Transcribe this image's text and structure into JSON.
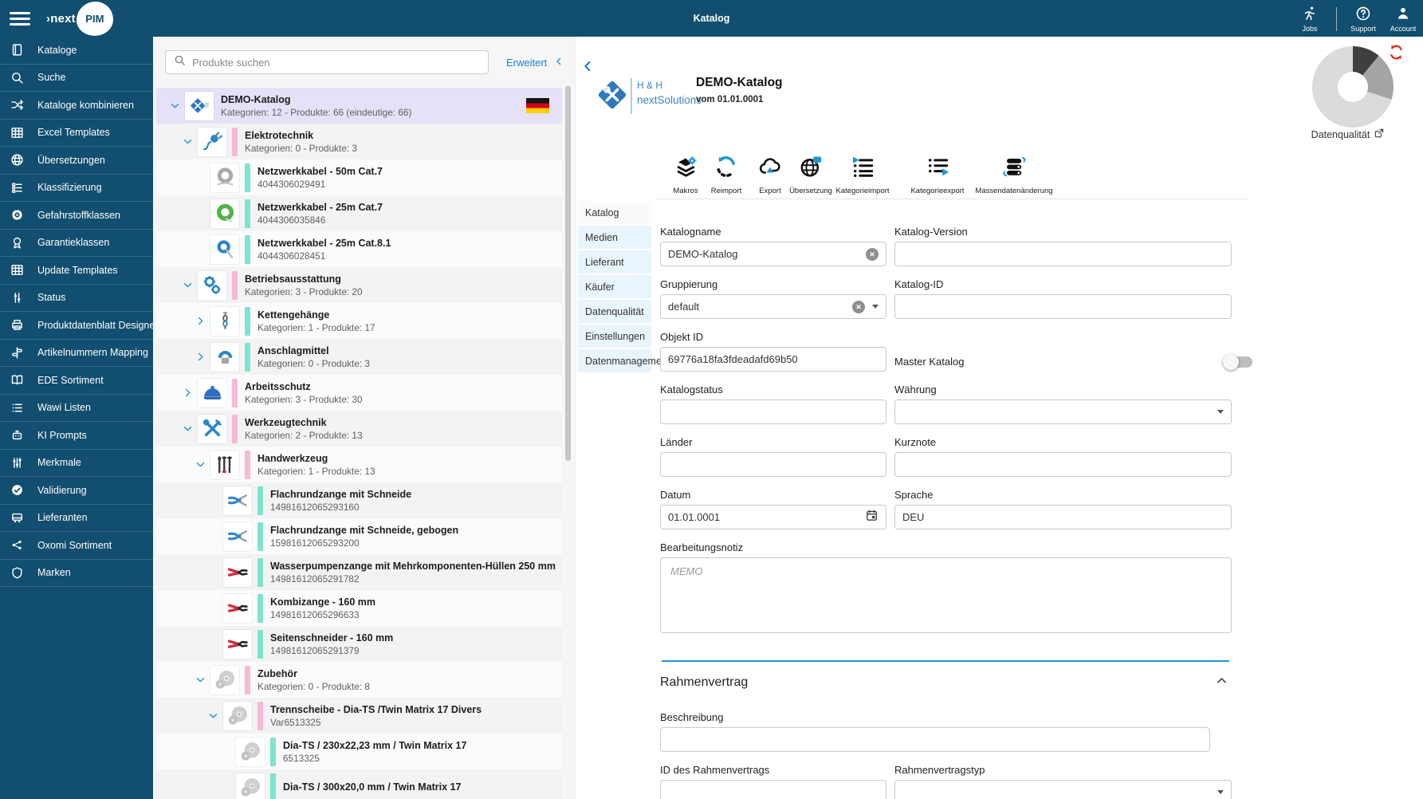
{
  "topbar": {
    "title": "Katalog",
    "logo": {
      "prefix": "›next",
      "suffix": "PIM"
    },
    "jobs_label": "Jobs",
    "support_label": "Support",
    "account_label": "Account"
  },
  "sidebar": {
    "items": [
      {
        "label": "Kataloge",
        "icon": "book-icon"
      },
      {
        "label": "Suche",
        "icon": "search-icon"
      },
      {
        "label": "Kataloge kombinieren",
        "icon": "shuffle-icon"
      },
      {
        "label": "Excel Templates",
        "icon": "table-icon"
      },
      {
        "label": "Übersetzungen",
        "icon": "globe-icon"
      },
      {
        "label": "Klassifizierung",
        "icon": "list-grid-icon"
      },
      {
        "label": "Gefahrstoffklassen",
        "icon": "radiation-icon"
      },
      {
        "label": "Garantieklassen",
        "icon": "award-icon"
      },
      {
        "label": "Update Templates",
        "icon": "table-icon"
      },
      {
        "label": "Status",
        "icon": "status-icon"
      },
      {
        "label": "Produktdatenblatt Designer",
        "icon": "printer-icon"
      },
      {
        "label": "Artikelnummern Mapping",
        "icon": "signpost-icon"
      },
      {
        "label": "EDE Sortiment",
        "icon": "open-book-icon"
      },
      {
        "label": "Wawi Listen",
        "icon": "list-icon"
      },
      {
        "label": "KI Prompts",
        "icon": "robot-icon"
      },
      {
        "label": "Merkmale",
        "icon": "sliders-icon"
      },
      {
        "label": "Validierung",
        "icon": "check-badge-icon"
      },
      {
        "label": "Lieferanten",
        "icon": "truck-icon"
      },
      {
        "label": "Oxomi Sortiment",
        "icon": "share-icon"
      },
      {
        "label": "Marken",
        "icon": "shield-icon"
      }
    ]
  },
  "tree": {
    "search_placeholder": "Produkte suchen",
    "advanced_label": "Erweitert",
    "rows": [
      {
        "level": 0,
        "chevron": "down",
        "thumb": "hh-logo",
        "bar": null,
        "title": "DEMO-Katalog",
        "subtitle": "Kategorien: 12 - Produkte: 66 (eindeutige: 66)",
        "selected": true,
        "flag": true
      },
      {
        "level": 1,
        "chevron": "down",
        "thumb": "plug",
        "bar": "pink",
        "title": "Elektrotechnik",
        "subtitle": "Kategorien: 0 - Produkte: 3"
      },
      {
        "level": 2,
        "chevron": null,
        "thumb": "cable-gray",
        "bar": "teal",
        "title": "Netzwerkkabel - 50m Cat.7",
        "subtitle": "4044306029491"
      },
      {
        "level": 2,
        "chevron": null,
        "thumb": "cable-green",
        "bar": "teal",
        "title": "Netzwerkkabel - 25m Cat.7",
        "subtitle": "4044306035846"
      },
      {
        "level": 2,
        "chevron": null,
        "thumb": "cable-blue",
        "bar": "teal",
        "title": "Netzwerkkabel - 25m Cat.8.1",
        "subtitle": "4044306028451"
      },
      {
        "level": 1,
        "chevron": "down",
        "thumb": "gears",
        "bar": "pink",
        "title": "Betriebsausstattung",
        "subtitle": "Kategorien: 3 - Produkte: 20"
      },
      {
        "level": 2,
        "chevron": "right",
        "thumb": "chain",
        "bar": "teal",
        "title": "Kettengehänge",
        "subtitle": "Kategorien: 1 - Produkte: 17"
      },
      {
        "level": 2,
        "chevron": "right",
        "thumb": "ring",
        "bar": "teal",
        "title": "Anschlagmittel",
        "subtitle": "Kategorien: 0 - Produkte: 3"
      },
      {
        "level": 1,
        "chevron": "right",
        "thumb": "helmet",
        "bar": "pink",
        "title": "Arbeitsschutz",
        "subtitle": "Kategorien: 3 - Produkte: 30"
      },
      {
        "level": 1,
        "chevron": "down",
        "thumb": "tools",
        "bar": "pink",
        "title": "Werkzeugtechnik",
        "subtitle": "Kategorien: 2 - Produkte: 13"
      },
      {
        "level": 2,
        "chevron": "down",
        "thumb": "handtools",
        "bar": "pink",
        "title": "Handwerkzeug",
        "subtitle": "Kategorien: 1 - Produkte: 13"
      },
      {
        "level": 3,
        "chevron": null,
        "thumb": "pliers-blue",
        "bar": "teal",
        "title": "Flachrundzange mit Schneide",
        "subtitle": "14981612065293160"
      },
      {
        "level": 3,
        "chevron": null,
        "thumb": "pliers-blue",
        "bar": "teal",
        "title": "Flachrundzange mit Schneide, gebogen",
        "subtitle": "15981612065293200"
      },
      {
        "level": 3,
        "chevron": null,
        "thumb": "pliers-red",
        "bar": "teal",
        "title": "Wasserpumpenzange mit Mehrkomponenten-Hüllen 250 mm",
        "subtitle": "14981612065291782"
      },
      {
        "level": 3,
        "chevron": null,
        "thumb": "pliers-red",
        "bar": "teal",
        "title": "Kombizange - 160 mm",
        "subtitle": "14981612065296633"
      },
      {
        "level": 3,
        "chevron": null,
        "thumb": "pliers-red",
        "bar": "teal",
        "title": "Seitenschneider - 160 mm",
        "subtitle": "14981612065291379"
      },
      {
        "level": 2,
        "chevron": "down",
        "thumb": "disc",
        "bar": "pink",
        "title": "Zubehör",
        "subtitle": "Kategorien: 0 - Produkte: 8"
      },
      {
        "level": 3,
        "chevron": "down",
        "thumb": "disc",
        "bar": "pink",
        "title": "Trennscheibe - Dia-TS /Twin Matrix 17 Divers",
        "subtitle": "Var6513325"
      },
      {
        "level": 4,
        "chevron": null,
        "thumb": "disc",
        "bar": "teal",
        "title": "Dia-TS / 230x22,23 mm / Twin Matrix 17",
        "subtitle": "6513325"
      },
      {
        "level": 4,
        "chevron": null,
        "thumb": "disc",
        "bar": "teal",
        "title": "Dia-TS / 300x20,0 mm / Twin Matrix 17",
        "subtitle": ""
      }
    ]
  },
  "detail": {
    "logo_line1": "H & H",
    "logo_line2": "nextSolutions",
    "title": "DEMO-Katalog",
    "subtitle": "vom 01.01.0001",
    "quality_label": "Datenqualität",
    "toolbar": [
      {
        "label": "Makros",
        "icon": "layers-gear-icon"
      },
      {
        "label": "Reimport",
        "icon": "reimport-icon"
      },
      {
        "label": "Export",
        "icon": "cloud-upload-icon"
      },
      {
        "label": "Übersetzung",
        "icon": "globe-chat-icon"
      },
      {
        "label": "Kategorieimport",
        "icon": "list-import-icon"
      },
      {
        "label": "Kategorieexport",
        "icon": "list-export-icon"
      },
      {
        "label": "Massendatenänderung",
        "icon": "database-sync-icon"
      }
    ],
    "tabs": [
      {
        "label": "Katalog",
        "active": true
      },
      {
        "label": "Medien",
        "active": false
      },
      {
        "label": "Lieferant",
        "active": false
      },
      {
        "label": "Käufer",
        "active": false
      },
      {
        "label": "Datenqualität",
        "active": false
      },
      {
        "label": "Einstellungen",
        "active": false
      },
      {
        "label": "Datenmanagement",
        "active": false
      }
    ],
    "form": {
      "katalogname": {
        "label": "Katalogname",
        "value": "DEMO-Katalog"
      },
      "katalog_version": {
        "label": "Katalog-Version",
        "value": ""
      },
      "gruppierung": {
        "label": "Gruppierung",
        "value": "default"
      },
      "katalog_id": {
        "label": "Katalog-ID",
        "value": ""
      },
      "objekt_id": {
        "label": "Objekt ID",
        "value": "69776a18fa3fdeadafd69b50"
      },
      "master_katalog": {
        "label": "Master Katalog",
        "enabled": false
      },
      "katalogstatus": {
        "label": "Katalogstatus",
        "value": ""
      },
      "waehrung": {
        "label": "Währung",
        "value": ""
      },
      "laender": {
        "label": "Länder",
        "value": ""
      },
      "kurznote": {
        "label": "Kurznote",
        "value": ""
      },
      "datum": {
        "label": "Datum",
        "value": "01.01.0001"
      },
      "sprache": {
        "label": "Sprache",
        "value": "DEU"
      },
      "bearbeitungsnotiz": {
        "label": "Bearbeitungsnotiz",
        "placeholder": "MEMO"
      }
    },
    "rahmenvertrag": {
      "title": "Rahmenvertrag",
      "beschreibung": {
        "label": "Beschreibung",
        "value": ""
      },
      "id": {
        "label": "ID des Rahmenvertrags",
        "value": ""
      },
      "typ": {
        "label": "Rahmenvertragstyp",
        "value": ""
      }
    }
  },
  "chart_data": {
    "type": "pie",
    "donut": true,
    "title": "Datenqualität",
    "segments": [
      {
        "value": 11,
        "color": "#3f3f3f"
      },
      {
        "value": 19,
        "color": "#a4a4a4"
      },
      {
        "value": 70,
        "color": "#dbdbdb"
      }
    ],
    "legend_position": "none"
  },
  "colors": {
    "topbar": "#114e6f",
    "accent_blue": "#1b96dc",
    "selected_row": "#e6e1f8",
    "bar_pink": "#f9b9d4",
    "bar_teal": "#7de4d0",
    "tab_bg": "#e9f5fc",
    "refresh_red": "#e8291c"
  }
}
